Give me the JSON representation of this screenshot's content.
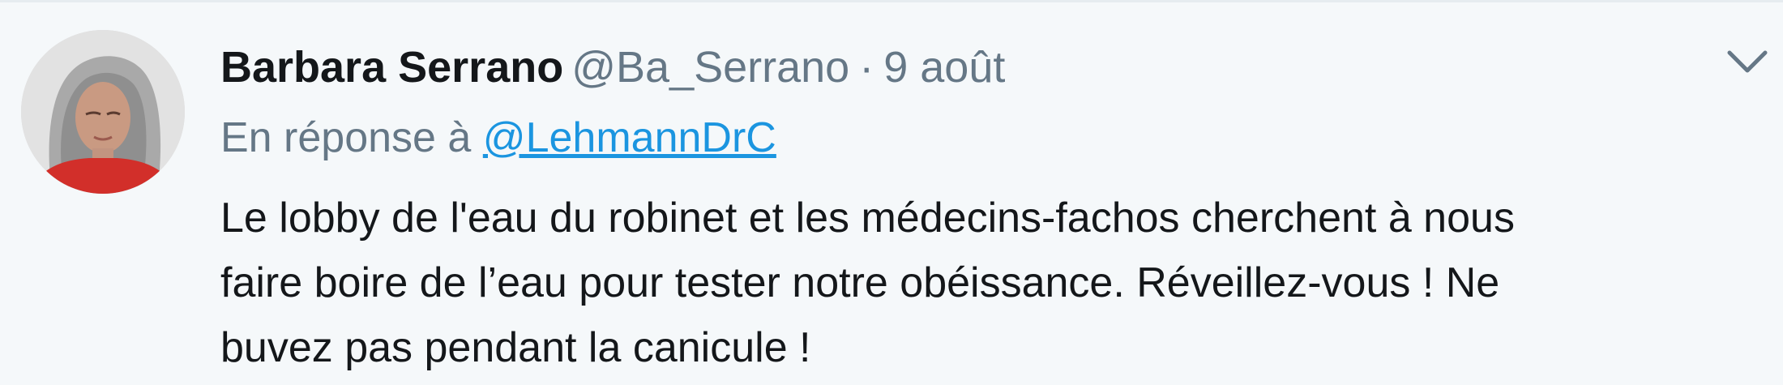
{
  "tweet": {
    "author_name": "Barbara Serrano",
    "author_handle": "@Ba_Serrano",
    "separator": "·",
    "date": "9 août",
    "reply_prefix": "En réponse à",
    "reply_to": "@LehmannDrC",
    "text_lines": [
      "Le lobby de l'eau du robinet et les médecins-fachos cherchent à nous",
      "faire boire de l’eau pour tester notre obéissance. Réveillez-vous ! Ne",
      "buvez pas pendant la canicule !"
    ]
  },
  "icons": {
    "avatar": "profile-photo",
    "menu": "chevron-down-icon"
  },
  "colors": {
    "background": "#f5f8fa",
    "name": "#14171a",
    "secondary": "#657786",
    "link": "#1b95e0"
  }
}
